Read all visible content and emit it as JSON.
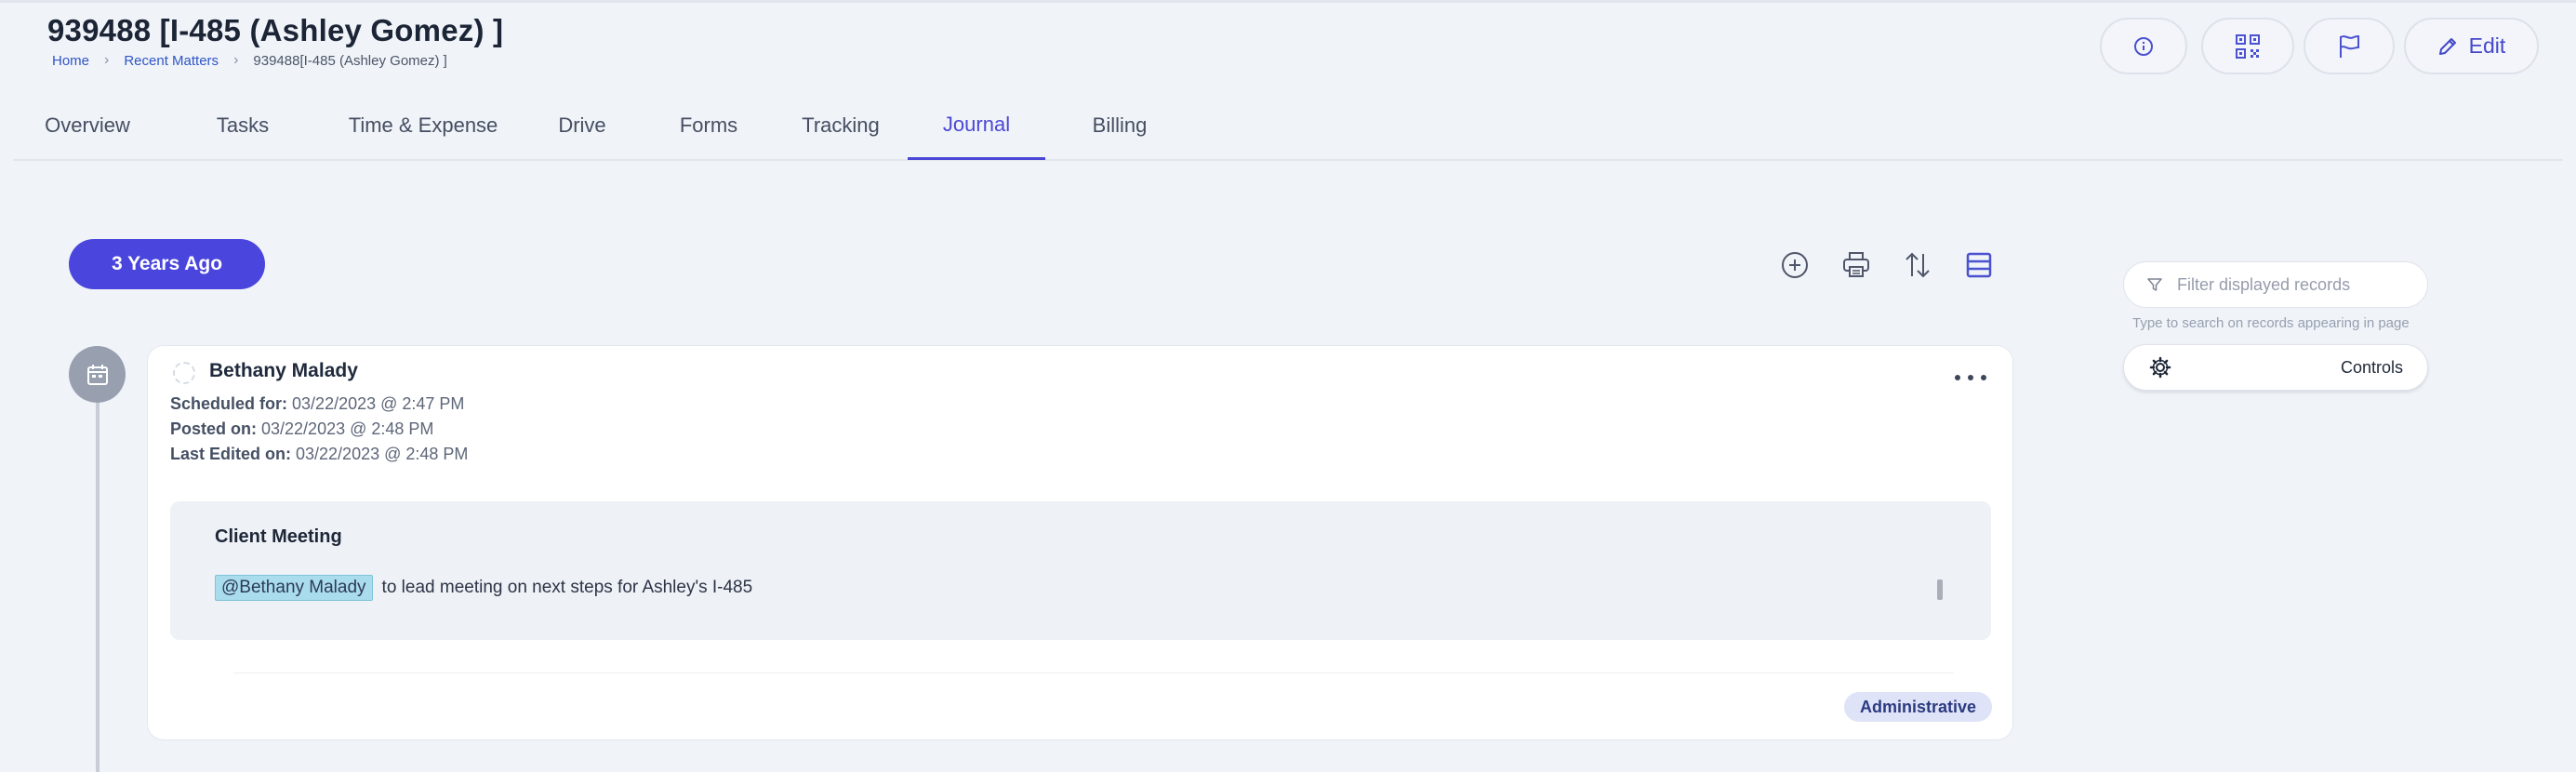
{
  "header": {
    "title": "939488 [I-485 (Ashley Gomez) ]",
    "breadcrumb": {
      "home": "Home",
      "recent": "Recent Matters",
      "current": "939488[I-485 (Ashley Gomez) ]"
    },
    "actions": {
      "info_icon": "info-icon",
      "qr_icon": "qr-code-icon",
      "flag_icon": "flag-icon",
      "edit_label": "Edit"
    }
  },
  "tabs": [
    {
      "label": "Overview",
      "active": false
    },
    {
      "label": "Tasks",
      "active": false
    },
    {
      "label": "Time & Expense",
      "active": false
    },
    {
      "label": "Drive",
      "active": false
    },
    {
      "label": "Forms",
      "active": false
    },
    {
      "label": "Tracking",
      "active": false
    },
    {
      "label": "Journal",
      "active": true
    },
    {
      "label": "Billing",
      "active": false
    }
  ],
  "timeline": {
    "group_label": "3 Years Ago",
    "toolbar": [
      "add-icon",
      "print-icon",
      "sort-icon",
      "layout-icon"
    ]
  },
  "entry": {
    "author": "Bethany Malady",
    "scheduled_label": "Scheduled for:",
    "scheduled_value": "03/22/2023 @ 2:47 PM",
    "posted_label": "Posted on:",
    "posted_value": "03/22/2023 @ 2:48 PM",
    "edited_label": "Last Edited on:",
    "edited_value": "03/22/2023 @ 2:48 PM",
    "note_title": "Client Meeting",
    "mention": "@Bethany Malady",
    "note_text": "to lead meeting on next steps for Ashley's I-485",
    "tag": "Administrative"
  },
  "sidebar": {
    "filter_placeholder": "Filter displayed records",
    "filter_hint": "Type to search on records appearing in page",
    "controls_label": "Controls"
  },
  "colors": {
    "accent": "#4a45dc",
    "background": "#f0f3f8",
    "tag_bg": "#dee3f7",
    "mention_bg": "#a9dcec"
  }
}
